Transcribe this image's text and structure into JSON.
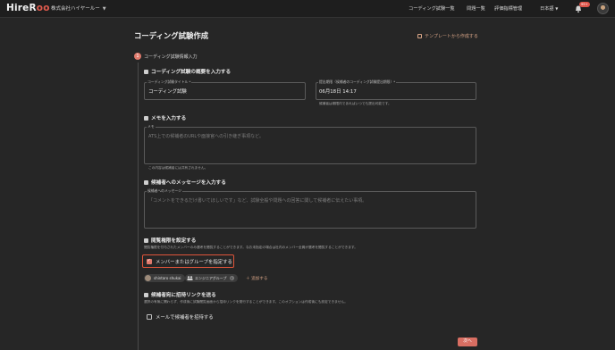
{
  "header": {
    "logo_main": "HireR",
    "logo_accent": "oo",
    "company": "株式会社ハイヤールー",
    "nav": [
      "コーディング試験一覧",
      "問題一覧",
      "評価指標管理"
    ],
    "language": "日本語",
    "notification_count": "99+"
  },
  "page": {
    "title": "コーディング試験作成",
    "template_link": "テンプレートから作成する"
  },
  "step": {
    "number": "1",
    "label": "コーディング試験情報入力"
  },
  "overview": {
    "title": "コーディング試験の概要を入力する",
    "name_label": "コーディング試験タイトル *",
    "name_value": "コーディング試験",
    "deadline_label": "提出期限（候補者のコーディング試験提出期限）*",
    "deadline_value": "06月18日 14:17",
    "deadline_help": "候補者は期限内であればいつでも提出可能です。"
  },
  "memo": {
    "title": "メモを入力する",
    "label": "メモ",
    "placeholder": "ATS上での候補者のURLや面接官への引き継ぎ事項など。",
    "help": "この内容は候補者には共有されません。"
  },
  "message": {
    "title": "候補者へのメッセージを入力する",
    "label": "候補者へのメッセージ",
    "placeholder": "「コメントをできるだけ書いてほしいです」など、試験全般や問題への回答に関して候補者に伝えたい事項。"
  },
  "access": {
    "title": "閲覧権限を設定する",
    "help": "閲覧権限を付与されたメンバーのみ選考を閲覧することができます。なお未指定の場合は社内のメンバー全員が選考を閲覧することができます。",
    "checkbox_label": "メンバーまたはグループを指定する",
    "chips": [
      "shintaro shukai",
      "エンジニアグループ"
    ],
    "add_label": "追加する"
  },
  "invite": {
    "title": "候補者宛に招待リンクを送る",
    "help": "選択の有無に関わらず、作成後に試験閲覧画面から招待リンクを発行することができます。このオプションは作成後にも設定できません。",
    "checkbox_label": "メールで候補者を招待する"
  },
  "footer": {
    "next_label": "次へ"
  },
  "colors": {
    "accent": "#e07a6c",
    "link": "#d7a486",
    "highlight": "#e0553a",
    "background": "#262626"
  }
}
